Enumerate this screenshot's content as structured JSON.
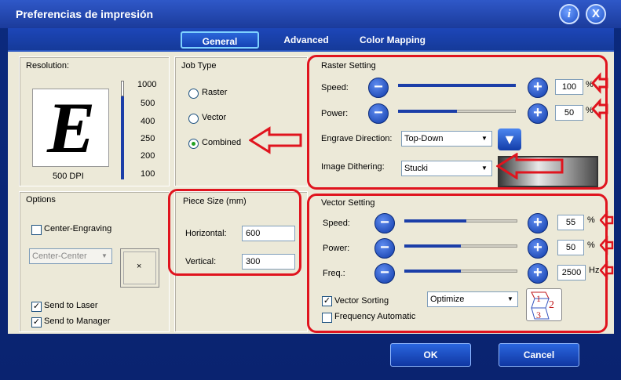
{
  "window": {
    "title": "Preferencias de impresión"
  },
  "tabs": [
    {
      "label": "General"
    },
    {
      "label": "Advanced"
    },
    {
      "label": "Color Mapping"
    }
  ],
  "resolution": {
    "label": "Resolution:",
    "preview_letter": "E",
    "current": "500 DPI",
    "scale": [
      "1000",
      "500",
      "400",
      "250",
      "200",
      "100"
    ]
  },
  "job_type": {
    "label": "Job Type",
    "options": [
      "Raster",
      "Vector",
      "Combined"
    ],
    "selected": "Combined"
  },
  "raster": {
    "label": "Raster Setting",
    "speed_label": "Speed:",
    "speed_value": "100",
    "speed_unit": "%",
    "speed_level": 1.0,
    "power_label": "Power:",
    "power_value": "50",
    "power_unit": "%",
    "power_level": 0.5,
    "direction_label": "Engrave Direction:",
    "direction_value": "Top-Down",
    "dithering_label": "Image Dithering:",
    "dithering_value": "Stucki"
  },
  "options": {
    "label": "Options",
    "center_engraving": "Center-Engraving",
    "center_select": "Center-Center",
    "send_laser": "Send to Laser",
    "send_manager": "Send to Manager"
  },
  "piece": {
    "label": "Piece Size (mm)",
    "horizontal_label": "Horizontal:",
    "horizontal_value": "600",
    "vertical_label": "Vertical:",
    "vertical_value": "300"
  },
  "vector": {
    "label": "Vector Setting",
    "speed_label": "Speed:",
    "speed_value": "55",
    "speed_unit": "%",
    "speed_level": 0.55,
    "power_label": "Power:",
    "power_value": "50",
    "power_unit": "%",
    "power_level": 0.5,
    "freq_label": "Freq.:",
    "freq_value": "2500",
    "freq_unit": "Hz",
    "freq_level": 0.5,
    "sorting_label": "Vector Sorting",
    "sorting_select": "Optimize",
    "freq_auto_label": "Frequency Automatic"
  },
  "buttons": {
    "ok": "OK",
    "cancel": "Cancel"
  },
  "icons": {
    "info": "i",
    "close": "X",
    "minus": "−",
    "plus": "+",
    "down": "▼"
  }
}
